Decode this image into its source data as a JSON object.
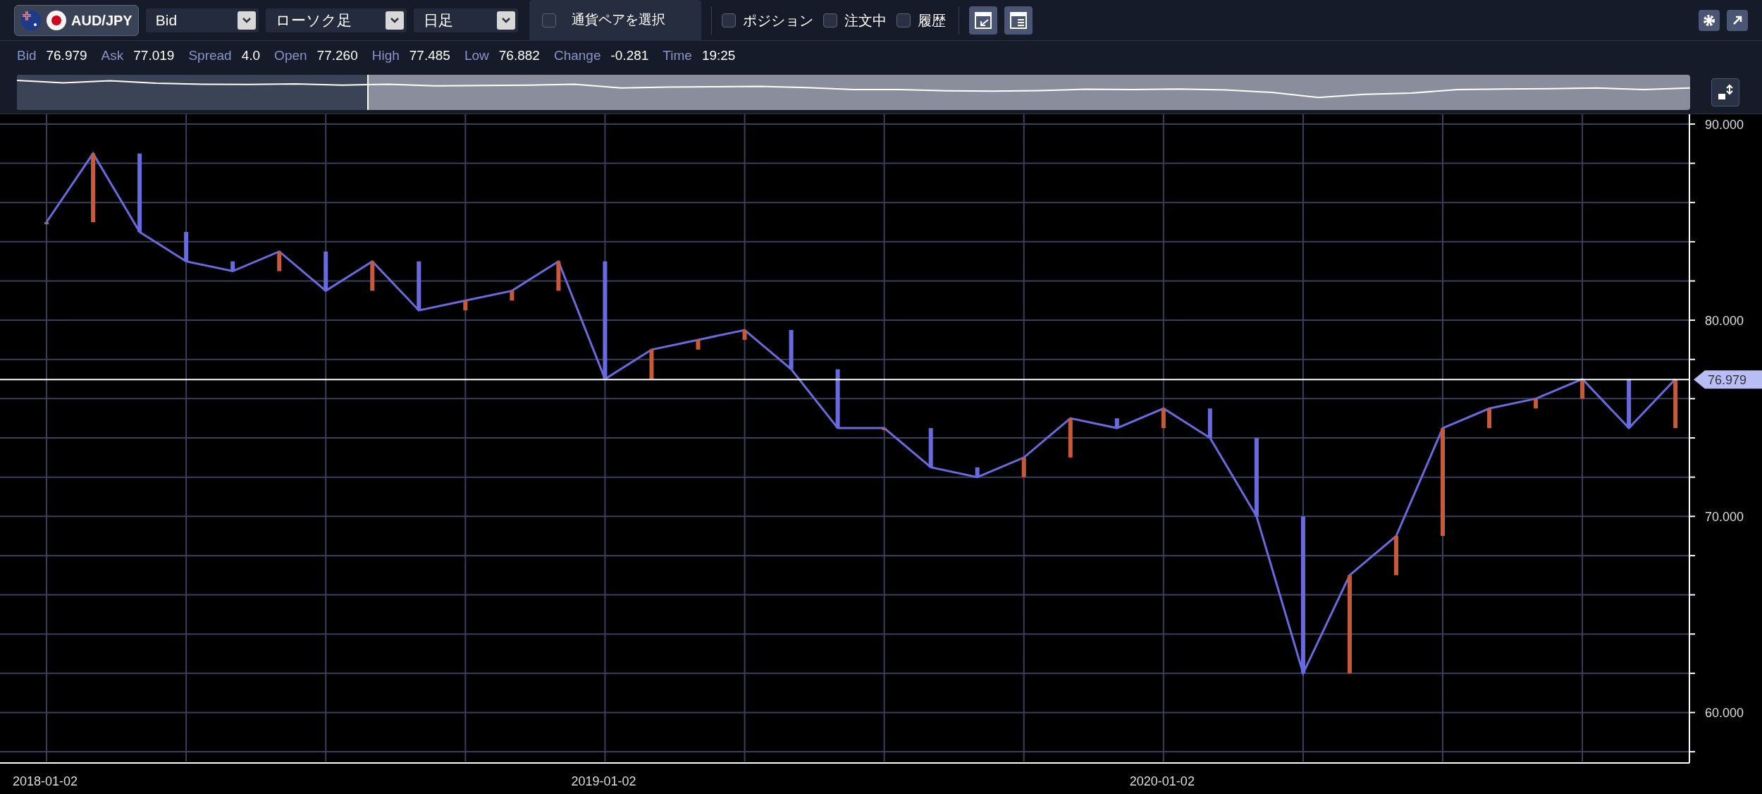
{
  "toolbar": {
    "pair": "AUD/JPY",
    "selects": [
      {
        "value": "Bid"
      },
      {
        "value": "ローソク足"
      },
      {
        "value": "日足"
      }
    ],
    "pair_select": {
      "label": "通貨ペアを選択",
      "checked": false
    },
    "filters": [
      {
        "label": "ポジション",
        "checked": false
      },
      {
        "label": "注文中",
        "checked": false
      },
      {
        "label": "履歴",
        "checked": false
      }
    ]
  },
  "quote": [
    {
      "label": "Bid",
      "value": "76.979"
    },
    {
      "label": "Ask",
      "value": "77.019"
    },
    {
      "label": "Spread",
      "value": "4.0"
    },
    {
      "label": "Open",
      "value": "77.260"
    },
    {
      "label": "High",
      "value": "77.485"
    },
    {
      "label": "Low",
      "value": "76.882"
    },
    {
      "label": "Change",
      "value": "-0.281"
    },
    {
      "label": "Time",
      "value": "19:25"
    }
  ],
  "navigator": {
    "level": 0.21
  },
  "chart": {
    "current_price": "76.979",
    "chart_data": {
      "type": "line",
      "categories": [
        "2018-01-02",
        null,
        null,
        null,
        null,
        null,
        null,
        null,
        null,
        null,
        null,
        null,
        "2019-01-02",
        null,
        null,
        null,
        null,
        null,
        null,
        null,
        null,
        null,
        null,
        null,
        "2020-01-02",
        null,
        null,
        null,
        null,
        null,
        null,
        null,
        null,
        null,
        null,
        null
      ],
      "series": [
        {
          "color": "#6a6ae0",
          "values": [
            85.0,
            88.5,
            84.5,
            83.0,
            82.5,
            83.5,
            81.5,
            83.0,
            80.5,
            81.0,
            81.5,
            83.0,
            77.0,
            78.5,
            79.0,
            79.5,
            77.5,
            74.5,
            74.5,
            72.5,
            72.0,
            73.0,
            75.0,
            74.5,
            75.5,
            74.0,
            70.0,
            62.0,
            67.0,
            69.0,
            74.5,
            75.5,
            76.0,
            77.0,
            74.5,
            77.0
          ]
        }
      ],
      "ylim": [
        57.5,
        90.5
      ],
      "grid": true,
      "ref_lines": [
        {
          "axis": "y",
          "value": 76.979
        }
      ],
      "yticks": [
        {
          "value": 60,
          "label": "60.000"
        },
        {
          "value": 70,
          "label": "70.000"
        },
        {
          "value": 80,
          "label": "80.000"
        },
        {
          "value": 90,
          "label": "90.000"
        }
      ]
    }
  }
}
